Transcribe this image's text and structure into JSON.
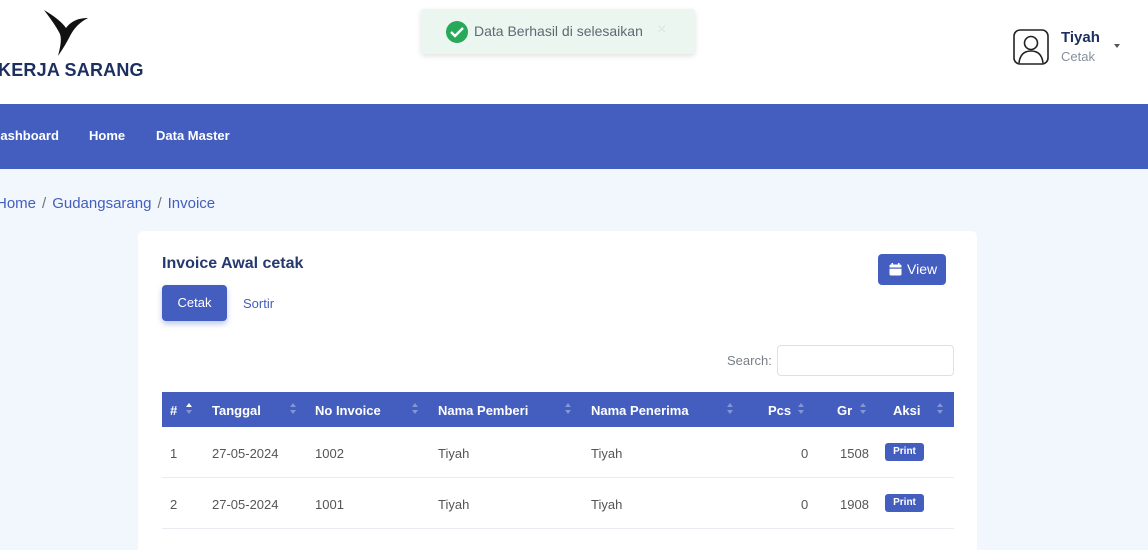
{
  "brand": {
    "name": "KERJA SARANG"
  },
  "toast": {
    "message": "Data Berhasil di selesaikan",
    "close": "×",
    "status_color": "#28a859"
  },
  "user": {
    "name": "Tiyah",
    "role": "Cetak"
  },
  "nav": {
    "items": [
      "Dashboard",
      "Home",
      "Data Master"
    ]
  },
  "breadcrumb": {
    "items": [
      "Home",
      "Gudangsarang",
      "Invoice"
    ]
  },
  "card": {
    "title": "Invoice Awal cetak",
    "view_label": "View",
    "tabs": [
      "Cetak",
      "Sortir"
    ],
    "active_tab": "Cetak",
    "search_label": "Search:",
    "search_value": ""
  },
  "table": {
    "columns": [
      "#",
      "Tanggal",
      "No Invoice",
      "Nama Pemberi",
      "Nama Penerima",
      "Pcs",
      "Gr",
      "Aksi"
    ],
    "rows": [
      {
        "no": "1",
        "tanggal": "27-05-2024",
        "invoice": "1002",
        "pemberi": "Tiyah",
        "penerima": "Tiyah",
        "pcs": "0",
        "gr": "1508",
        "aksi": "Print"
      },
      {
        "no": "2",
        "tanggal": "27-05-2024",
        "invoice": "1001",
        "pemberi": "Tiyah",
        "penerima": "Tiyah",
        "pcs": "0",
        "gr": "1908",
        "aksi": "Print"
      }
    ]
  },
  "colors": {
    "primary": "#435ebe",
    "background": "#f2f6fd",
    "heading": "#25396f"
  }
}
